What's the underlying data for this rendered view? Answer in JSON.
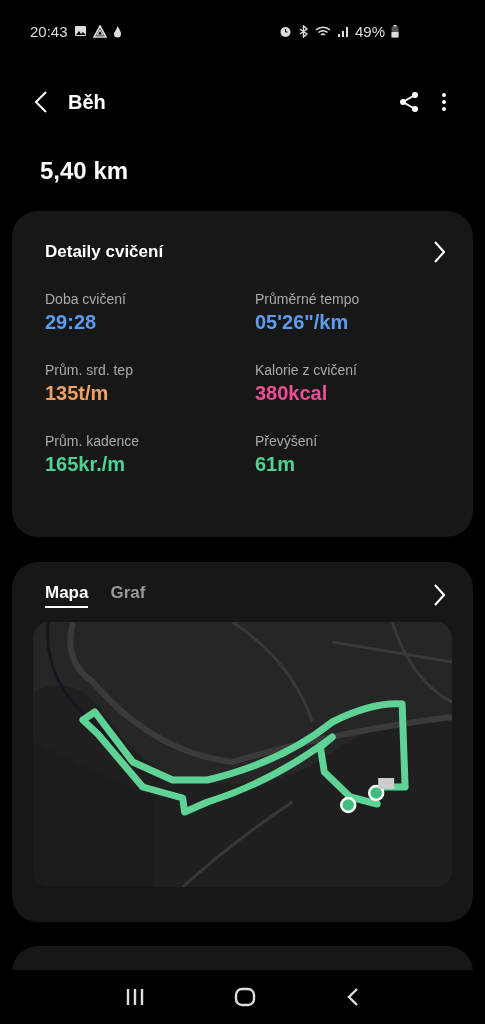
{
  "status_bar": {
    "time": "20:43",
    "battery": "49%"
  },
  "header": {
    "title": "Běh"
  },
  "distance": "5,40 km",
  "details": {
    "title": "Detaily cvičení",
    "stats": [
      {
        "label": "Doba cvičení",
        "value": "29:28",
        "color": "#5b9ef0"
      },
      {
        "label": "Průměrné tempo",
        "value": "05'26\"/km",
        "color": "#5b9ef0"
      },
      {
        "label": "Prům. srd. tep",
        "value": "135t/m",
        "color": "#f0a060"
      },
      {
        "label": "Kalorie z cvičení",
        "value": "380kcal",
        "color": "#ec4f94"
      },
      {
        "label": "Prům. kadence",
        "value": "165kr./m",
        "color": "#4fd391"
      },
      {
        "label": "Převýšení",
        "value": "61m",
        "color": "#4fd391"
      }
    ]
  },
  "route": {
    "tabs": [
      {
        "label": "Mapa",
        "selected": true
      },
      {
        "label": "Graf",
        "selected": false
      }
    ]
  }
}
